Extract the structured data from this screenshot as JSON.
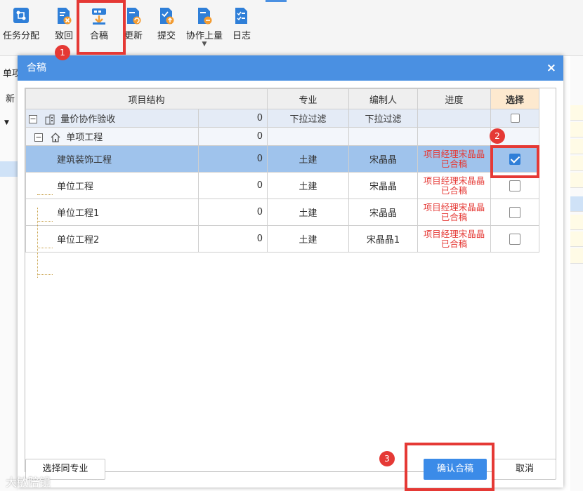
{
  "toolbar": {
    "buttons": [
      {
        "label": "任务分配",
        "icon": "task-assign-icon",
        "color": "#2f7fd8"
      },
      {
        "label": "致回",
        "icon": "return-icon",
        "color": "#2f7fd8"
      },
      {
        "label": "合稿",
        "icon": "merge-icon",
        "color": "#2f7fd8"
      },
      {
        "label": "更新",
        "icon": "update-icon",
        "color": "#2f7fd8"
      },
      {
        "label": "提交",
        "icon": "submit-icon",
        "color": "#2f7fd8"
      },
      {
        "label": "协作上量",
        "icon": "collab-upload-icon",
        "color": "#2f7fd8",
        "has_dropdown": true
      },
      {
        "label": "日志",
        "icon": "log-icon",
        "color": "#2f7fd8"
      }
    ]
  },
  "background": {
    "fragment_1": "单项",
    "fragment_2": "新"
  },
  "annotations": {
    "step1": "1",
    "step2": "2",
    "step3": "3",
    "highlight_color": "#e53935"
  },
  "dialog": {
    "title": "合稿",
    "close_symbol": "×",
    "header_color": "#4a90e2",
    "columns": {
      "structure": "项目结构",
      "specialty": "专业",
      "editor": "编制人",
      "progress": "进度",
      "select": "选择"
    },
    "rows": [
      {
        "type": "root",
        "name": "量价协作验收",
        "value": "0",
        "specialty": "下拉过滤",
        "editor": "下拉过滤",
        "progress": "",
        "checked": false
      },
      {
        "type": "group",
        "name": "单项工程",
        "value": "0",
        "specialty": "",
        "editor": "",
        "progress": "",
        "checked": false
      },
      {
        "type": "item",
        "name": "建筑装饰工程",
        "value": "0",
        "specialty": "土建",
        "editor": "宋晶晶",
        "progress_line1": "项目经理宋晶晶",
        "progress_line2": "已合稿",
        "checked": true,
        "selected": true
      },
      {
        "type": "item",
        "name": "单位工程",
        "value": "0",
        "specialty": "土建",
        "editor": "宋晶晶",
        "progress_line1": "项目经理宋晶晶",
        "progress_line2": "已合稿",
        "checked": false
      },
      {
        "type": "item",
        "name": "单位工程1",
        "value": "0",
        "specialty": "土建",
        "editor": "宋晶晶",
        "progress_line1": "项目经理宋晶晶",
        "progress_line2": "已合稿",
        "checked": false
      },
      {
        "type": "item",
        "name": "单位工程2",
        "value": "0",
        "specialty": "土建",
        "editor": "宋晶晶1",
        "progress_line1": "项目经理宋晶晶",
        "progress_line2": "已合稿",
        "checked": false
      }
    ],
    "buttons": {
      "select_same": "选择同专业",
      "confirm": "确认合稿",
      "cancel": "取消"
    }
  },
  "watermark": "大敏陪镜"
}
